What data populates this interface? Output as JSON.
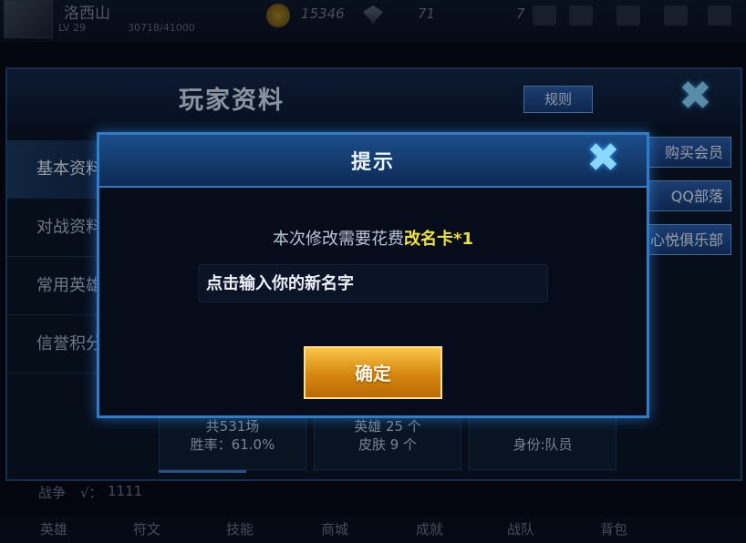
{
  "topbar": {
    "player_name": "洛西山",
    "level": "LV 29",
    "exp": "30718/41000",
    "coins": "15346",
    "tickets": "71",
    "diamonds": "7"
  },
  "panel": {
    "title": "玩家资料",
    "rules_label": "规则",
    "tabs": [
      {
        "label": "基本资料"
      },
      {
        "label": "对战资料"
      },
      {
        "label": "常用英雄"
      },
      {
        "label": "信誉积分"
      }
    ],
    "side_buttons": [
      {
        "label": "购买会员"
      },
      {
        "label": "QQ部落"
      },
      {
        "label": "心悦俱乐部"
      }
    ],
    "stats": [
      {
        "line1": "共531场",
        "line2": "胜率：61.0%"
      },
      {
        "line1": "英雄 25 个",
        "line2": "皮肤 9 个"
      },
      {
        "line1": "",
        "line2": "身份:队员"
      }
    ],
    "battle_label": "战争",
    "battle_value": "1111"
  },
  "navbar": {
    "items": [
      {
        "label": "英雄"
      },
      {
        "label": "符文"
      },
      {
        "label": "技能"
      },
      {
        "label": "商城"
      },
      {
        "label": "成就"
      },
      {
        "label": "战队"
      },
      {
        "label": "背包"
      }
    ]
  },
  "modal": {
    "title": "提示",
    "cost_text": "本次修改需要花费",
    "cost_item": "改名卡*1",
    "input_placeholder": "点击输入你的新名字",
    "confirm_label": "确定"
  },
  "colors": {
    "highlight": "#f2e23a",
    "confirm_gold": "#f0a62a",
    "border_blue": "#2f7cc8"
  }
}
